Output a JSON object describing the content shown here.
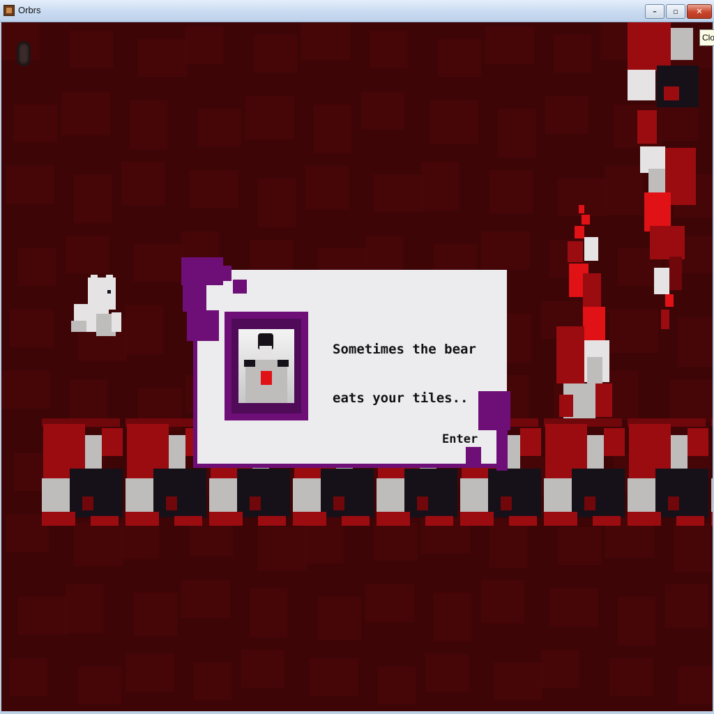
{
  "window": {
    "title": "Orbrs",
    "controls": {
      "minimize": "–",
      "maximize": "▫",
      "close": "✕"
    },
    "tooltip": "Clo"
  },
  "dialog": {
    "line1": "Sometimes the bear",
    "line2": "eats your tiles..",
    "continue_label": "Enter"
  },
  "colors": {
    "background": "#3e0507",
    "dialog_border": "#6e0f78",
    "tile_red": "#9b0c11",
    "tile_grey": "#bfbcbc",
    "tile_black": "#161018"
  }
}
